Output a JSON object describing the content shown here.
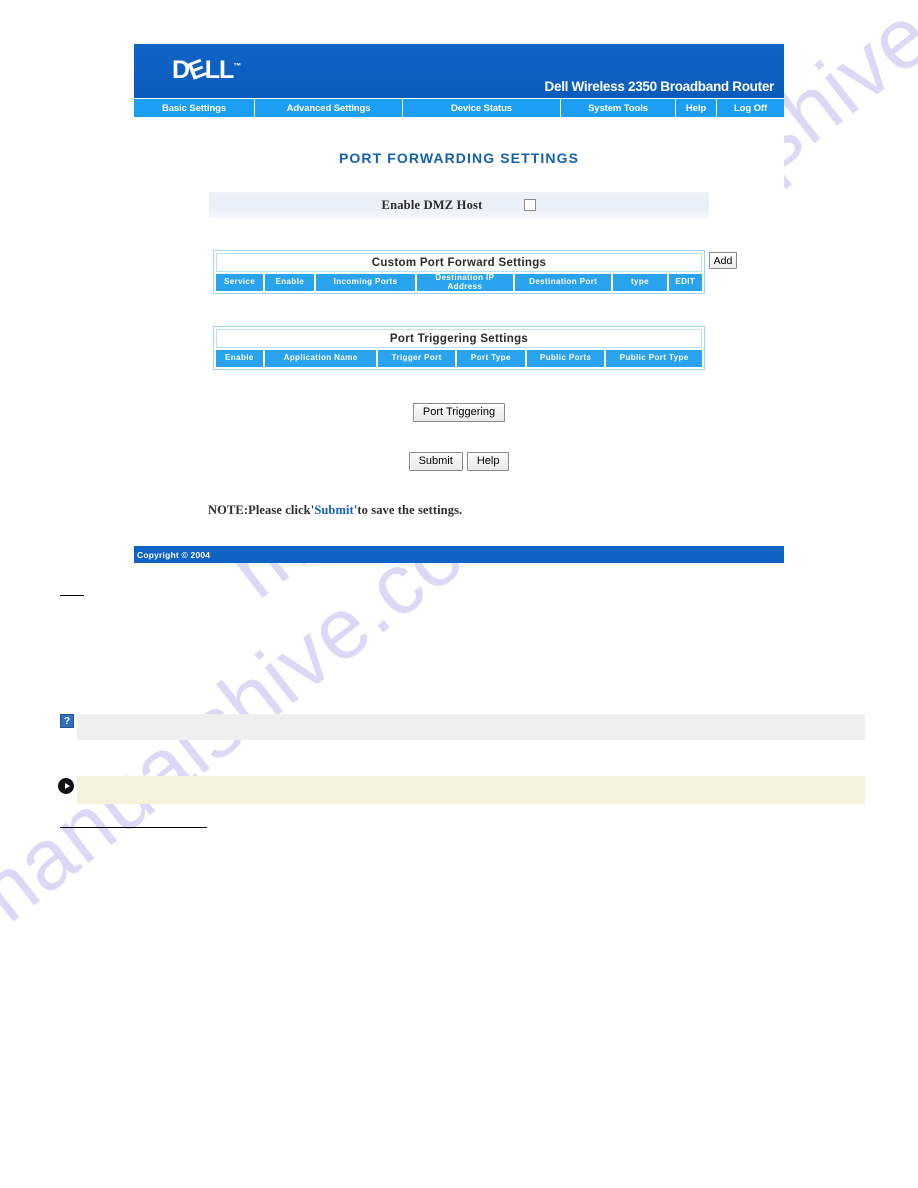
{
  "watermark": {
    "text": "manualshive.com"
  },
  "header": {
    "logo_text_parts": {
      "d": "D",
      "e": "E",
      "ll": "LL",
      "tm": "™"
    },
    "logo_name": "DELL",
    "product_name": "Dell Wireless 2350 Broadband Router"
  },
  "nav": {
    "items": [
      {
        "label": "Basic Settings",
        "name": "nav-basic-settings"
      },
      {
        "label": "Advanced Settings",
        "name": "nav-advanced-settings"
      },
      {
        "label": "Device Status",
        "name": "nav-device-status"
      },
      {
        "label": "System Tools",
        "name": "nav-system-tools"
      },
      {
        "label": "Help",
        "name": "nav-help"
      },
      {
        "label": "Log Off",
        "name": "nav-log-off"
      }
    ]
  },
  "main": {
    "page_title": "PORT FORWARDING SETTINGS",
    "dmz": {
      "label": "Enable DMZ Host",
      "checked": false
    },
    "custom_port_forward": {
      "caption": "Custom Port Forward Settings",
      "add_button": "Add",
      "columns": [
        "Service",
        "Enable",
        "Incoming Ports",
        "Destination IP Address",
        "Destination Port",
        "type",
        "EDIT"
      ],
      "rows": []
    },
    "port_triggering": {
      "caption": "Port Triggering Settings",
      "columns": [
        "Enable",
        "Application Name",
        "Trigger Port",
        "Port Type",
        "Public Ports",
        "Public Port Type"
      ],
      "rows": []
    },
    "buttons": {
      "port_triggering": "Port Triggering",
      "submit": "Submit",
      "help": "Help"
    },
    "note": {
      "prefix": "NOTE:Please click'",
      "link": "Submit",
      "suffix": "'to save the settings."
    }
  },
  "footer": {
    "copyright": "Copyright © 2004"
  },
  "doc_annotations": {
    "help_icon_glyph": "?",
    "help_bar_text": "",
    "note_bar_text": ""
  },
  "colors": {
    "header_blue": "#0f63c4",
    "nav_blue": "#1c9ef2",
    "title_blue": "#1262ad",
    "table_header_blue": "#29a3ee",
    "dmz_row_bg": "#eef3fa",
    "help_bar_bg": "#efefef",
    "note_bar_bg": "#f2f2dd",
    "watermark": "#cfcdf2"
  }
}
